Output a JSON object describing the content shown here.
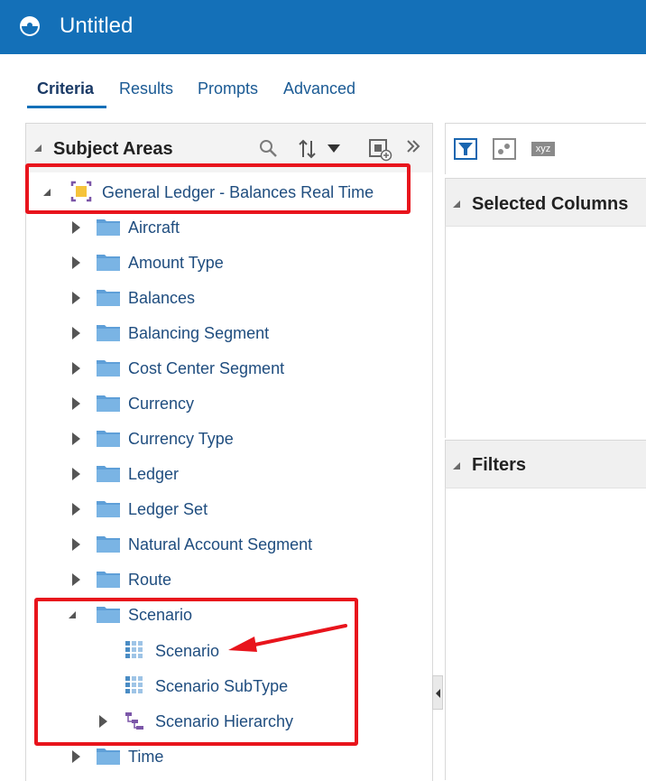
{
  "header": {
    "title": "Untitled"
  },
  "tabs": [
    {
      "label": "Criteria",
      "active": true
    },
    {
      "label": "Results",
      "active": false
    },
    {
      "label": "Prompts",
      "active": false
    },
    {
      "label": "Advanced",
      "active": false
    }
  ],
  "subject_areas": {
    "title": "Subject Areas",
    "tools": [
      "search-icon",
      "sort-icon",
      "add-subject-area-icon",
      "expand-panel-icon"
    ],
    "root": "General Ledger - Balances Real Time",
    "folders": [
      "Aircraft",
      "Amount Type",
      "Balances",
      "Balancing Segment",
      "Cost Center Segment",
      "Currency",
      "Currency Type",
      "Ledger",
      "Ledger Set",
      "Natural Account Segment",
      "Route",
      "Scenario",
      "Time"
    ],
    "scenario_children": [
      "Scenario",
      "Scenario SubType",
      "Scenario Hierarchy"
    ]
  },
  "right_panel": {
    "toolbar_icons": [
      "filter-icon",
      "edit-formula-icon",
      "xyz-icon"
    ],
    "xyz_label": "xyz",
    "selected_columns_title": "Selected Columns",
    "filters_title": "Filters"
  },
  "colors": {
    "header_bg": "#1470b8",
    "link_text": "#1f4d7f",
    "highlight_red": "#e8141c",
    "folder_blue": "#7ab4e4"
  }
}
